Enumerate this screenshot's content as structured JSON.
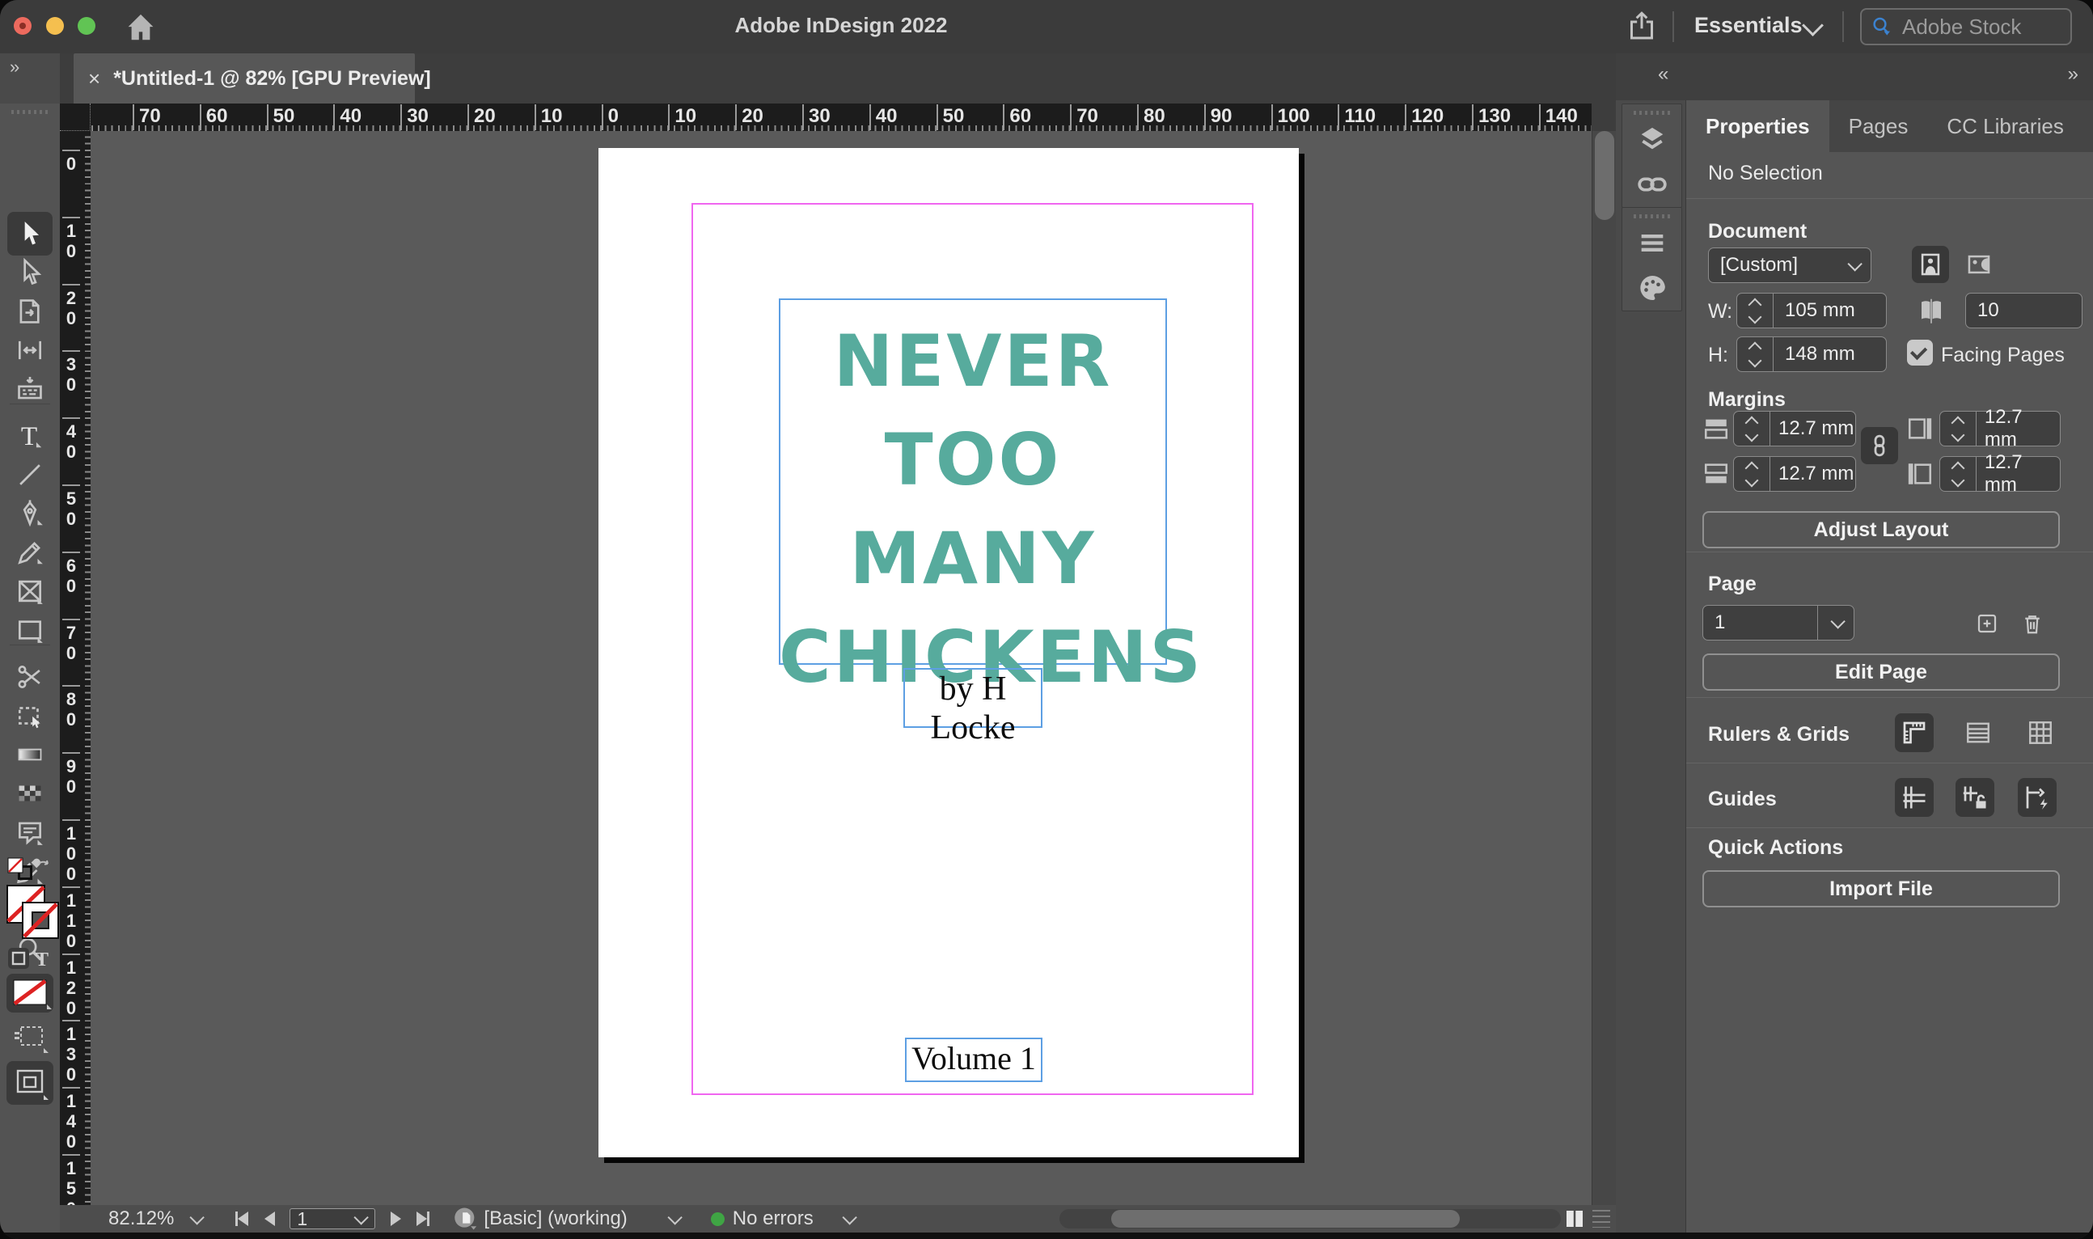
{
  "window": {
    "title": "Adobe InDesign 2022",
    "workspace": "Essentials",
    "search_placeholder": "Adobe Stock"
  },
  "icons_text": {
    "close_tab": "×",
    "expand_right": "»",
    "collapse_left": "«"
  },
  "colors": {
    "title_teal": "#57ab9d",
    "margin_guide_magenta": "#f066f0",
    "frame_border_blue": "#5d9fe3",
    "no_error_green": "#3fa544",
    "traffic_red": "#ed6a5e",
    "traffic_yellow": "#f5bf4f",
    "traffic_green": "#61c454"
  },
  "tab": {
    "title": "*Untitled-1 @ 82% [GPU Preview]"
  },
  "rulers": {
    "horizontal_labels": [
      "70",
      "60",
      "50",
      "40",
      "30",
      "20",
      "10",
      "0",
      "10",
      "20",
      "30",
      "40",
      "50",
      "60",
      "70",
      "80",
      "90",
      "100",
      "110",
      "120",
      "130",
      "140"
    ],
    "vertical_labels": [
      "0",
      "10",
      "20",
      "30",
      "40",
      "50",
      "60",
      "70",
      "80",
      "90",
      "100",
      "110",
      "120",
      "130",
      "140",
      "150"
    ]
  },
  "toolbar": {
    "selected_tool": "selection",
    "tools": [
      {
        "name": "selection",
        "icon": "selection"
      },
      {
        "name": "direct-selection",
        "icon": "direct"
      },
      {
        "name": "page-tool",
        "icon": "page"
      },
      {
        "name": "gap-tool",
        "icon": "gap"
      },
      {
        "name": "content-collector",
        "icon": "collector"
      },
      {
        "name": "type-tool",
        "icon": "type"
      },
      {
        "name": "line-tool",
        "icon": "line"
      },
      {
        "name": "pen-tool",
        "icon": "pen"
      },
      {
        "name": "pencil-tool",
        "icon": "pencil"
      },
      {
        "name": "frame-tool",
        "icon": "frame"
      },
      {
        "name": "rectangle-tool",
        "icon": "rect"
      },
      {
        "name": "scissors-tool",
        "icon": "scissors"
      },
      {
        "name": "free-transform-tool",
        "icon": "transform"
      },
      {
        "name": "gradient-tool",
        "icon": "gradient"
      },
      {
        "name": "gradient-feather-tool",
        "icon": "feather"
      },
      {
        "name": "note-tool",
        "icon": "note"
      },
      {
        "name": "eyedropper-tool",
        "icon": "eyedropper"
      },
      {
        "name": "hand-tool",
        "icon": "hand"
      },
      {
        "name": "zoom-tool",
        "icon": "zoom"
      }
    ]
  },
  "document_page": {
    "title_lines": [
      "NEVER",
      "TOO MANY",
      "CHICKENS"
    ],
    "author": "by H Locke",
    "volume": "Volume 1"
  },
  "properties_panel": {
    "tabs": [
      "Properties",
      "Pages",
      "CC Libraries"
    ],
    "selected_tab": "Properties",
    "selection_status": "No Selection",
    "document": {
      "label": "Document",
      "preset": "[Custom]",
      "w_label": "W:",
      "w_value": "105 mm",
      "h_label": "H:",
      "h_value": "148 mm",
      "pages_count": "10",
      "facing_pages_label": "Facing Pages"
    },
    "margins": {
      "label": "Margins",
      "top": "12.7 mm",
      "bottom": "12.7 mm",
      "inside": "12.7 mm",
      "outside": "12.7 mm"
    },
    "adjust_layout_label": "Adjust Layout",
    "page": {
      "label": "Page",
      "current": "1",
      "edit_label": "Edit Page"
    },
    "rulers_grids_label": "Rulers & Grids",
    "guides_label": "Guides",
    "quick_actions_label": "Quick Actions",
    "import_file_label": "Import File"
  },
  "status_bar": {
    "zoom_level": "82.12%",
    "page_number": "1",
    "preflight_profile": "[Basic] (working)",
    "error_status": "No errors"
  }
}
